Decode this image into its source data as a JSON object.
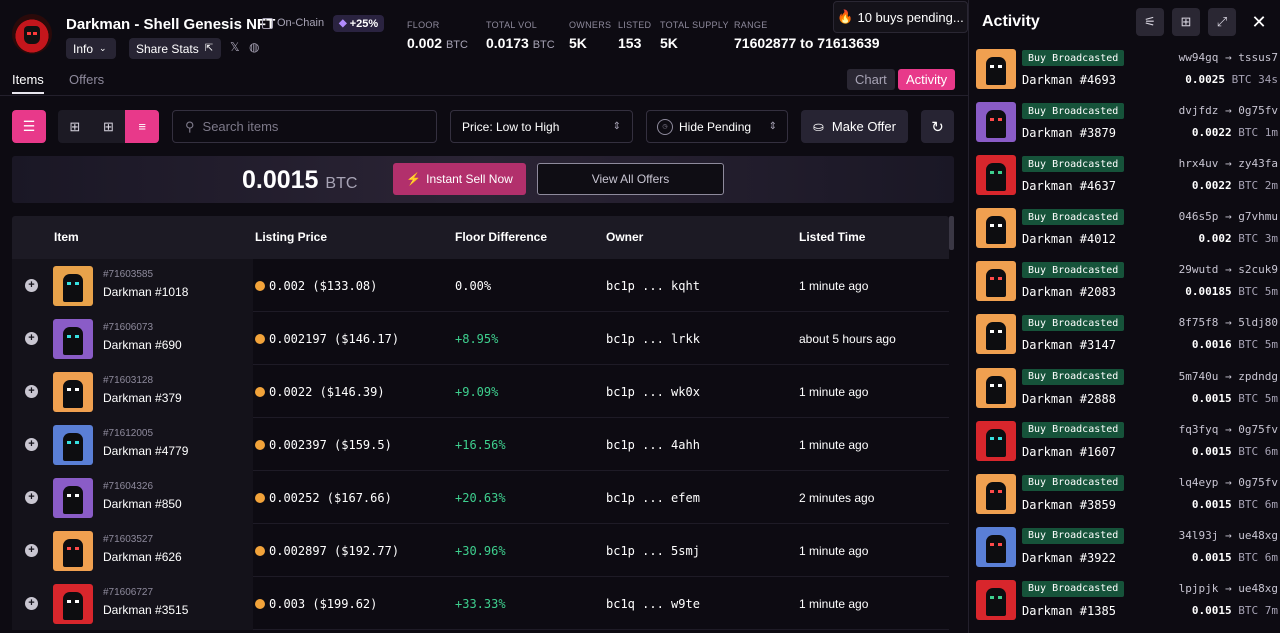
{
  "colors": {
    "accent": "#e8398a",
    "positive": "#3ecf8e",
    "badge_green": "#16533a",
    "btc_orange": "#f2a33a"
  },
  "collection": {
    "title": "Darkman - Shell Genesis NFT",
    "onchain_label": "On-Chain",
    "boost_badge": "+25%",
    "info_label": "Info",
    "share_label": "Share Stats"
  },
  "stats": [
    {
      "label": "FLOOR",
      "value": "0.002",
      "unit": "BTC"
    },
    {
      "label": "TOTAL VOL",
      "value": "0.0173",
      "unit": "BTC"
    },
    {
      "label": "OWNERS",
      "value": "5K",
      "unit": ""
    },
    {
      "label": "LISTED",
      "value": "153",
      "unit": ""
    },
    {
      "label": "TOTAL SUPPLY",
      "value": "5K",
      "unit": ""
    },
    {
      "label": "RANGE",
      "value": "71602877 to 71613639",
      "unit": ""
    }
  ],
  "pending": {
    "label": "10 buys pending..."
  },
  "tabs": {
    "items": "Items",
    "offers": "Offers",
    "chart": "Chart",
    "activity": "Activity"
  },
  "toolbar": {
    "search_placeholder": "Search items",
    "sort_label": "Price: Low to High",
    "pending_label": "Hide Pending",
    "make_offer": "Make Offer"
  },
  "sell": {
    "price": "0.0015",
    "unit": "BTC",
    "instant_label": "Instant Sell Now",
    "view_offers_label": "View All Offers"
  },
  "table": {
    "headers": {
      "item": "Item",
      "price": "Listing Price",
      "diff": "Floor Difference",
      "owner": "Owner",
      "time": "Listed Time"
    },
    "rows": [
      {
        "inscription": "#71603585",
        "name": "Darkman #1018",
        "price": "0.002 ($133.08)",
        "diff": "0.00%",
        "owner": "bc1p ... kqht",
        "time": "1 minute ago",
        "bg": "#e8a24a",
        "eye": "#37e0e0"
      },
      {
        "inscription": "#71606073",
        "name": "Darkman #690",
        "price": "0.002197 ($146.17)",
        "diff": "+8.95%",
        "owner": "bc1p ... lrkk",
        "time": "about 5 hours ago",
        "bg": "#8a5cc7",
        "eye": "#37e0e0"
      },
      {
        "inscription": "#71603128",
        "name": "Darkman #379",
        "price": "0.0022 ($146.39)",
        "diff": "+9.09%",
        "owner": "bc1p ... wk0x",
        "time": "1 minute ago",
        "bg": "#f0a050",
        "eye": "#ffffff"
      },
      {
        "inscription": "#71612005",
        "name": "Darkman #4779",
        "price": "0.002397 ($159.5)",
        "diff": "+16.56%",
        "owner": "bc1p ... 4ahh",
        "time": "1 minute ago",
        "bg": "#5a7fd6",
        "eye": "#37e0e0"
      },
      {
        "inscription": "#71604326",
        "name": "Darkman #850",
        "price": "0.00252 ($167.66)",
        "diff": "+20.63%",
        "owner": "bc1p ... efem",
        "time": "2 minutes ago",
        "bg": "#8a5cc7",
        "eye": "#ffffff"
      },
      {
        "inscription": "#71603527",
        "name": "Darkman #626",
        "price": "0.002897 ($192.77)",
        "diff": "+30.96%",
        "owner": "bc1p ... 5smj",
        "time": "1 minute ago",
        "bg": "#f0a050",
        "eye": "#ff4a4a"
      },
      {
        "inscription": "#71606727",
        "name": "Darkman #3515",
        "price": "0.003 ($199.62)",
        "diff": "+33.33%",
        "owner": "bc1q ... w9te",
        "time": "1 minute ago",
        "bg": "#d8262c",
        "eye": "#ffffff"
      }
    ]
  },
  "activity": {
    "title": "Activity",
    "items": [
      {
        "badge": "Buy Broadcasted",
        "name": "Darkman #4693",
        "from": "ww94gq",
        "to": "tssus7",
        "price": "0.0025",
        "unit": "BTC",
        "age": "34s",
        "bg": "#f0a050",
        "eye": "#ffffff"
      },
      {
        "badge": "Buy Broadcasted",
        "name": "Darkman #3879",
        "from": "dvjfdz",
        "to": "0g75fv",
        "price": "0.0022",
        "unit": "BTC",
        "age": "1m",
        "bg": "#8a5cc7",
        "eye": "#ff4a4a"
      },
      {
        "badge": "Buy Broadcasted",
        "name": "Darkman #4637",
        "from": "hrx4uv",
        "to": "zy43fa",
        "price": "0.0022",
        "unit": "BTC",
        "age": "2m",
        "bg": "#d8262c",
        "eye": "#3ecf8e"
      },
      {
        "badge": "Buy Broadcasted",
        "name": "Darkman #4012",
        "from": "046s5p",
        "to": "g7vhmu",
        "price": "0.002",
        "unit": "BTC",
        "age": "3m",
        "bg": "#f0a050",
        "eye": "#ffffff"
      },
      {
        "badge": "Buy Broadcasted",
        "name": "Darkman #2083",
        "from": "29wutd",
        "to": "s2cuk9",
        "price": "0.00185",
        "unit": "BTC",
        "age": "5m",
        "bg": "#f0a050",
        "eye": "#ff4a4a"
      },
      {
        "badge": "Buy Broadcasted",
        "name": "Darkman #3147",
        "from": "8f75f8",
        "to": "5ldj80",
        "price": "0.0016",
        "unit": "BTC",
        "age": "5m",
        "bg": "#f0a050",
        "eye": "#ffffff"
      },
      {
        "badge": "Buy Broadcasted",
        "name": "Darkman #2888",
        "from": "5m740u",
        "to": "zpdndg",
        "price": "0.0015",
        "unit": "BTC",
        "age": "5m",
        "bg": "#f0a050",
        "eye": "#ffffff"
      },
      {
        "badge": "Buy Broadcasted",
        "name": "Darkman #1607",
        "from": "fq3fyq",
        "to": "0g75fv",
        "price": "0.0015",
        "unit": "BTC",
        "age": "6m",
        "bg": "#d8262c",
        "eye": "#37e0e0"
      },
      {
        "badge": "Buy Broadcasted",
        "name": "Darkman #3859",
        "from": "lq4eyp",
        "to": "0g75fv",
        "price": "0.0015",
        "unit": "BTC",
        "age": "6m",
        "bg": "#f0a050",
        "eye": "#ff4a4a"
      },
      {
        "badge": "Buy Broadcasted",
        "name": "Darkman #3922",
        "from": "34l93j",
        "to": "ue48xg",
        "price": "0.0015",
        "unit": "BTC",
        "age": "6m",
        "bg": "#5a7fd6",
        "eye": "#ff4a4a"
      },
      {
        "badge": "Buy Broadcasted",
        "name": "Darkman #1385",
        "from": "lpjpjk",
        "to": "ue48xg",
        "price": "0.0015",
        "unit": "BTC",
        "age": "7m",
        "bg": "#d8262c",
        "eye": "#3ecf8e"
      }
    ]
  }
}
